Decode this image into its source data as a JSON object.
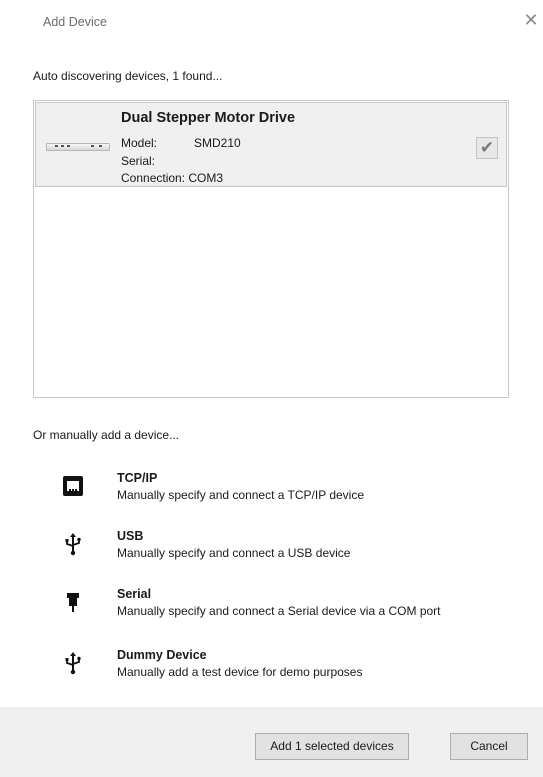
{
  "dialog": {
    "title": "Add Device",
    "close_symbol": "✕"
  },
  "discovery": {
    "status": "Auto discovering devices,  1 found..."
  },
  "devices": [
    {
      "name": "Dual Stepper Motor Drive",
      "model_label": "Model:",
      "model_value": "SMD210",
      "serial_label": "Serial:",
      "connection": "Connection: COM3",
      "selected": true,
      "check_symbol": "✔"
    }
  ],
  "manual": {
    "header": "Or manually add a device...",
    "options": [
      {
        "title": "TCP/IP",
        "description": "Manually specify and connect a TCP/IP device",
        "icon": "ethernet-port-icon"
      },
      {
        "title": "USB",
        "description": "Manually specify and connect a USB device",
        "icon": "usb-icon"
      },
      {
        "title": "Serial",
        "description": "Manually specify and connect a Serial device via a COM port",
        "icon": "serial-connector-icon"
      },
      {
        "title": "Dummy Device",
        "description": "Manually add a test device for demo purposes",
        "icon": "usb-icon"
      }
    ]
  },
  "footer": {
    "add_label": "Add 1 selected devices",
    "cancel_label": "Cancel"
  }
}
